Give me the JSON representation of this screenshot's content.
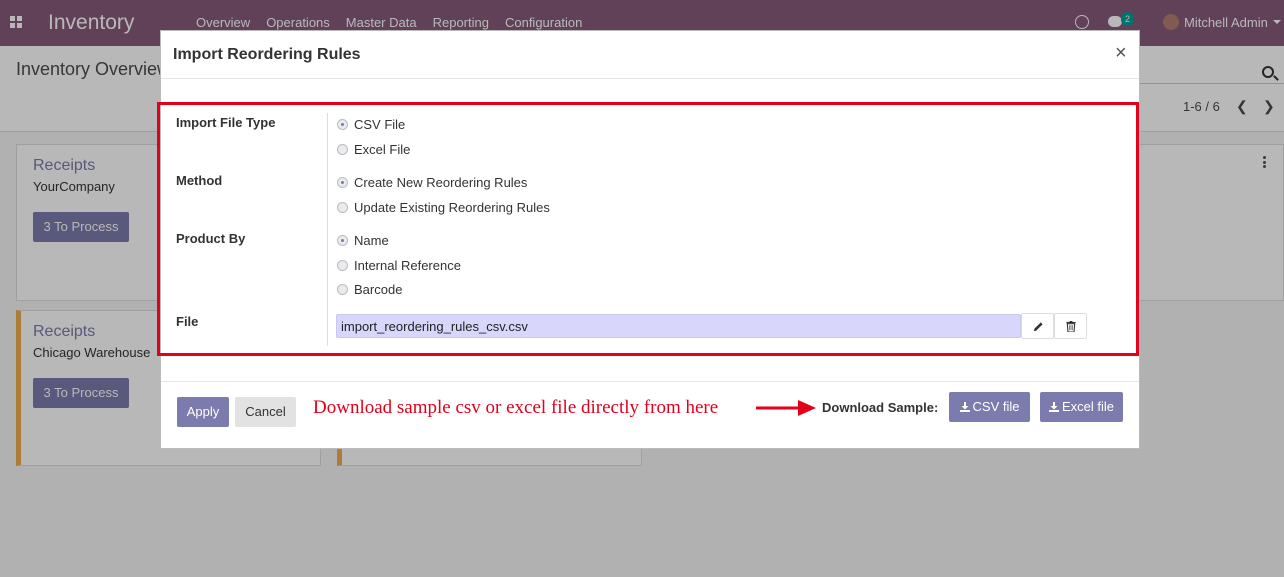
{
  "navbar": {
    "app_title": "Inventory",
    "menu": [
      "Overview",
      "Operations",
      "Master Data",
      "Reporting",
      "Configuration"
    ],
    "chat_count": "2",
    "user_name": "Mitchell Admin"
  },
  "control_panel": {
    "breadcrumb": "Inventory Overview",
    "pager": "1-6 / 6"
  },
  "cards": [
    {
      "title": "Receipts",
      "company": "YourCompany",
      "button": "3 To Process"
    },
    {
      "title": "Receipts",
      "company": "Chicago Warehouse",
      "button": "3 To Process"
    }
  ],
  "dialog": {
    "title": "Import Reordering Rules",
    "close_symbol": "×",
    "import_file_type": {
      "label": "Import File Type",
      "options": [
        "CSV File",
        "Excel File"
      ],
      "selected": "CSV File"
    },
    "method": {
      "label": "Method",
      "options": [
        "Create New Reordering Rules",
        "Update Existing Reordering Rules"
      ],
      "selected": "Create New Reordering Rules"
    },
    "product_by": {
      "label": "Product By",
      "options": [
        "Name",
        "Internal Reference",
        "Barcode"
      ],
      "selected": "Name"
    },
    "file": {
      "label": "File",
      "value": "import_reordering_rules_csv.csv"
    },
    "footer": {
      "apply_label": "Apply",
      "cancel_label": "Cancel",
      "annotation": "Download sample csv or excel file directly from here",
      "download_sample_label": "Download Sample:",
      "csv_file_label": "CSV file",
      "excel_file_label": "Excel file"
    }
  },
  "colors": {
    "brand": "#875a7b",
    "accent": "#7c7bad",
    "highlight": "#e3001b"
  }
}
